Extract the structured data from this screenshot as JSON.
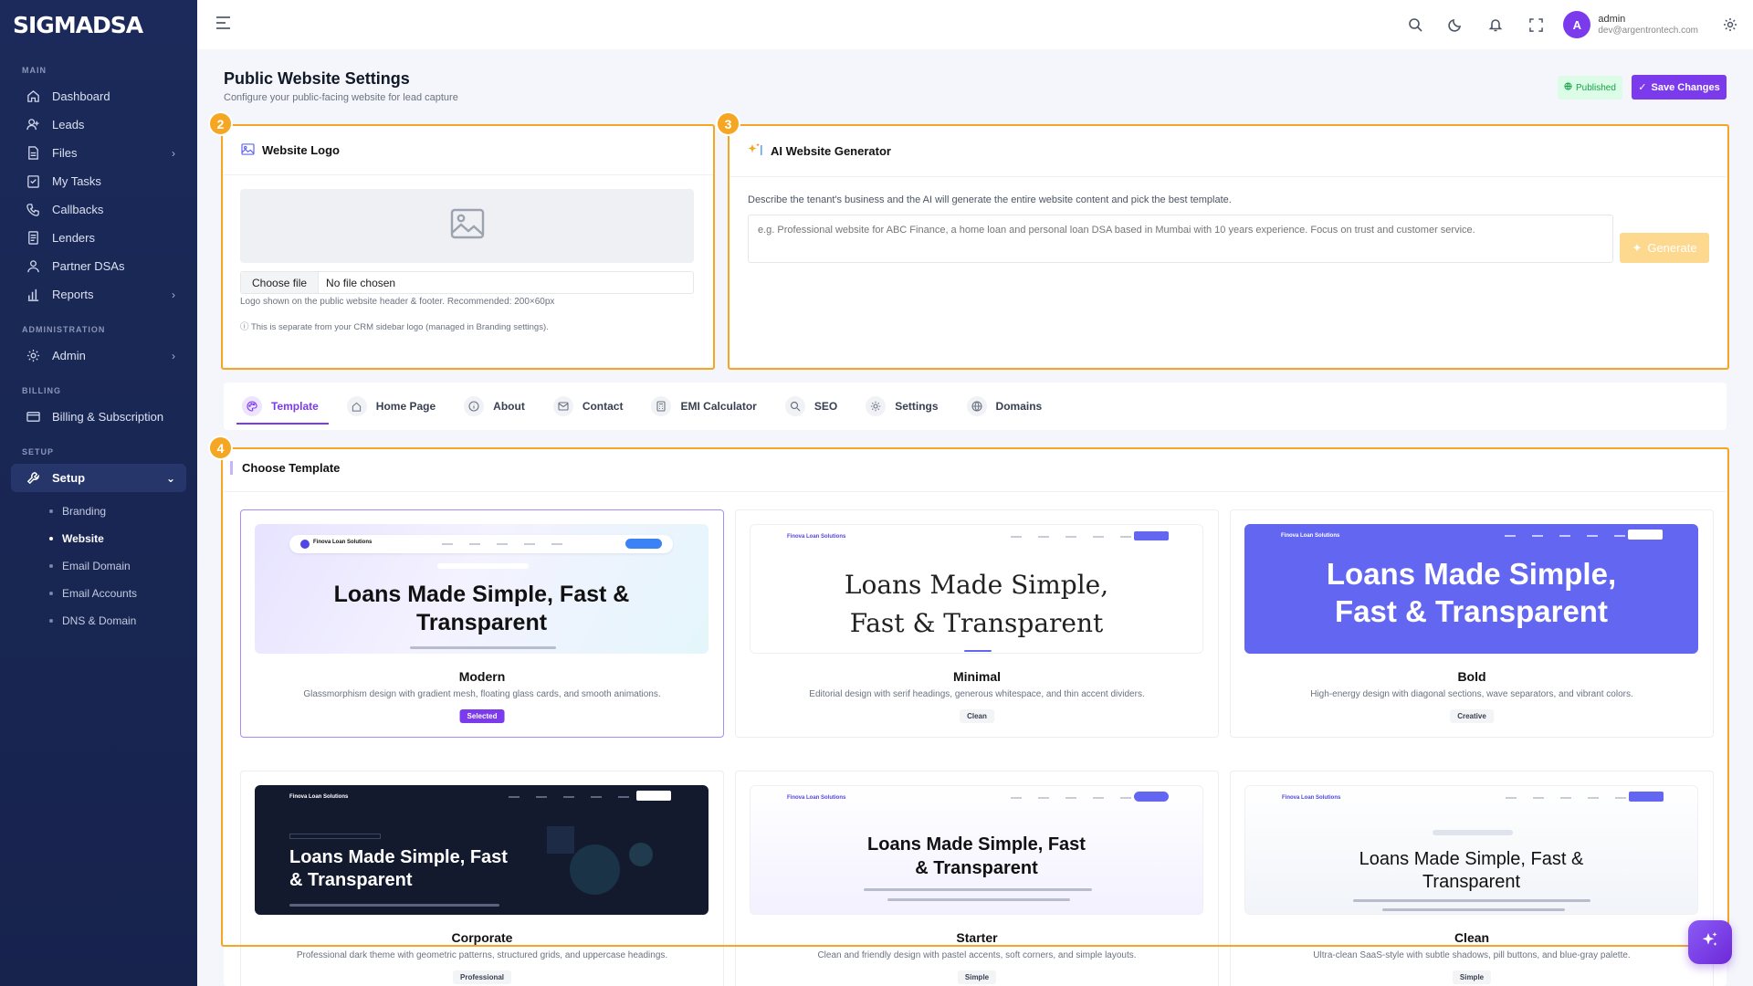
{
  "app": {
    "brand": "SIGMADSA"
  },
  "sidebar": {
    "sections": {
      "main": "MAIN",
      "administration": "ADMINISTRATION",
      "billing": "BILLING",
      "setup": "SETUP"
    },
    "items": {
      "dashboard": "Dashboard",
      "leads": "Leads",
      "files": "Files",
      "my_tasks": "My Tasks",
      "callbacks": "Callbacks",
      "lenders": "Lenders",
      "partner_dsas": "Partner DSAs",
      "reports": "Reports",
      "admin": "Admin",
      "billing": "Billing & Subscription",
      "setup": "Setup"
    },
    "setup_sub": [
      "Branding",
      "Website",
      "Email Domain",
      "Email Accounts",
      "DNS & Domain"
    ]
  },
  "topbar": {
    "user_name": "admin",
    "user_email": "dev@argentrontech.com",
    "avatar_initial": "A"
  },
  "page": {
    "title": "Public Website Settings",
    "subtitle": "Configure your public-facing website for lead capture",
    "status": "Published",
    "save_label": "Save Changes"
  },
  "annotations": {
    "logo": "2",
    "ai": "3",
    "template": "4"
  },
  "logo_card": {
    "title": "Website Logo",
    "choose_file": "Choose file",
    "no_file": "No file chosen",
    "hint": "Logo shown on the public website header & footer. Recommended: 200×60px",
    "note": "ⓘ This is separate from your CRM sidebar logo (managed in Branding settings)."
  },
  "ai_card": {
    "title": "AI Website Generator",
    "description": "Describe the tenant's business and the AI will generate the entire website content and pick the best template.",
    "placeholder": "e.g. Professional website for ABC Finance, a home loan and personal loan DSA based in Mumbai with 10 years experience. Focus on trust and customer service.",
    "generate_label": "Generate"
  },
  "tabs": [
    "Template",
    "Home Page",
    "About",
    "Contact",
    "EMI Calculator",
    "SEO",
    "Settings",
    "Domains"
  ],
  "templates_section": {
    "title": "Choose Template",
    "preview_brand": "Finova Loan Solutions",
    "preview_headline": "Loans Made Simple, Fast & Transparent",
    "preview_headline_bold": "Loans Made Simple, Fast & Transparent",
    "templates": [
      {
        "name": "Modern",
        "desc": "Glassmorphism design with gradient mesh, floating glass cards, and smooth animations.",
        "tag": "Selected"
      },
      {
        "name": "Minimal",
        "desc": "Editorial design with serif headings, generous whitespace, and thin accent dividers.",
        "tag": "Clean"
      },
      {
        "name": "Bold",
        "desc": "High-energy design with diagonal sections, wave separators, and vibrant colors.",
        "tag": "Creative"
      },
      {
        "name": "Corporate",
        "desc": "Professional dark theme with geometric patterns, structured grids, and uppercase headings.",
        "tag": "Professional"
      },
      {
        "name": "Starter",
        "desc": "Clean and friendly design with pastel accents, soft corners, and simple layouts.",
        "tag": "Simple"
      },
      {
        "name": "Clean",
        "desc": "Ultra-clean SaaS-style with subtle shadows, pill buttons, and blue-gray palette.",
        "tag": "Simple"
      }
    ]
  },
  "colors": {
    "accent": "#7c3aed",
    "highlight": "#f5a623",
    "sidebar": "#1b2a5a"
  }
}
